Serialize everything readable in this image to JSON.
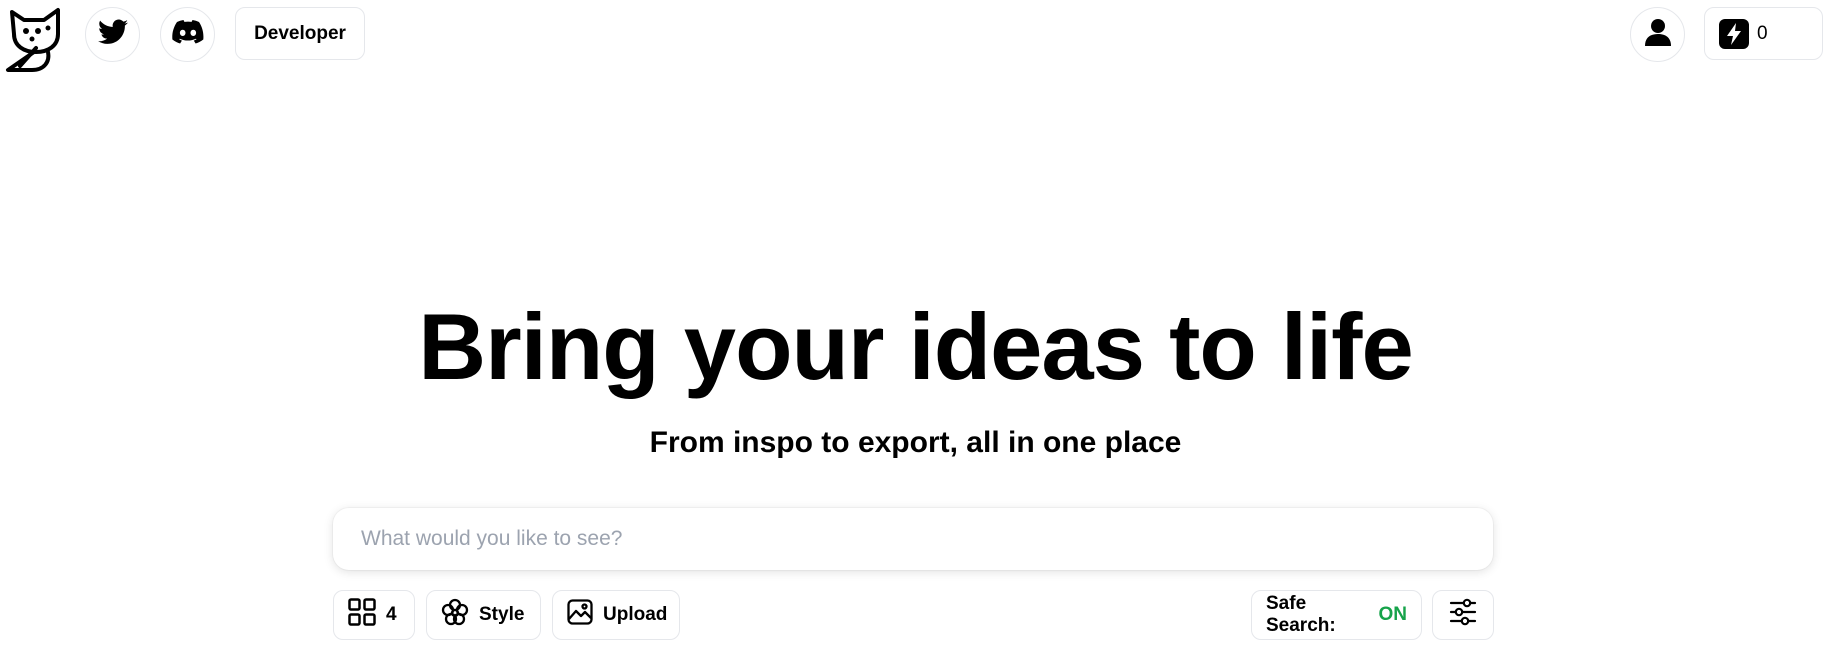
{
  "header": {
    "developer_label": "Developer",
    "credits_count": "0",
    "icons": [
      "cat-logo-icon",
      "twitter-icon",
      "discord-icon",
      "user-icon",
      "bolt-icon"
    ]
  },
  "hero": {
    "title": "Bring your ideas to life",
    "subtitle": "From inspo to export, all in one place"
  },
  "search": {
    "placeholder": "What would you like to see?",
    "value": ""
  },
  "toolbar": {
    "count_label": "4",
    "style_label": "Style",
    "upload_label": "Upload",
    "safe_search_label": "Safe Search:",
    "safe_search_value": "ON"
  },
  "colors": {
    "accent_on": "#16a34a",
    "border": "#e5e7eb",
    "placeholder": "#9ca3af"
  }
}
